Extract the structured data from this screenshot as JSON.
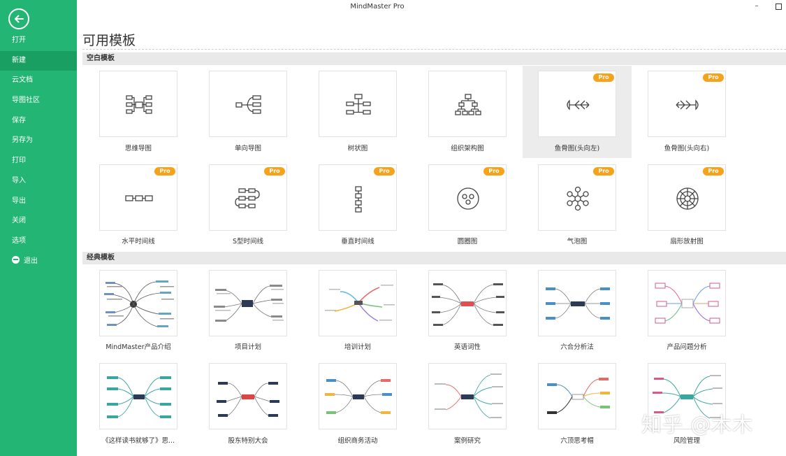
{
  "app_title": "MindMaster Pro",
  "window": {
    "minimize_label": "–",
    "maximize_label": ""
  },
  "sidebar": {
    "items": [
      {
        "label": "打开"
      },
      {
        "label": "新建"
      },
      {
        "label": "云文档"
      },
      {
        "label": "导图社区"
      },
      {
        "label": "保存"
      },
      {
        "label": "另存为"
      },
      {
        "label": "打印"
      },
      {
        "label": "导入"
      },
      {
        "label": "导出"
      },
      {
        "label": "关闭"
      },
      {
        "label": "选项"
      },
      {
        "label": "退出"
      }
    ],
    "active_index": 1
  },
  "page_title": "可用模板",
  "sections": {
    "blank": {
      "label": "空白模板",
      "tiles": [
        {
          "label": "思维导图",
          "pro": "",
          "icon": "mindmap-icon"
        },
        {
          "label": "单向导图",
          "pro": "",
          "icon": "right-map-icon"
        },
        {
          "label": "树状图",
          "pro": "",
          "icon": "tree-icon"
        },
        {
          "label": "组织架构图",
          "pro": "",
          "icon": "org-chart-icon"
        },
        {
          "label": "鱼骨图(头向左)",
          "pro": "Pro",
          "icon": "fishbone-left-icon"
        },
        {
          "label": "鱼骨图(头向右)",
          "pro": "Pro",
          "icon": "fishbone-right-icon"
        },
        {
          "label": "水平时间线",
          "pro": "Pro",
          "icon": "horizontal-timeline-icon"
        },
        {
          "label": "S型时间线",
          "pro": "Pro",
          "icon": "s-timeline-icon"
        },
        {
          "label": "垂直时间线",
          "pro": "Pro",
          "icon": "vertical-timeline-icon"
        },
        {
          "label": "圆圈图",
          "pro": "Pro",
          "icon": "circle-map-icon"
        },
        {
          "label": "气泡图",
          "pro": "Pro",
          "icon": "bubble-map-icon"
        },
        {
          "label": "扇形放射图",
          "pro": "Pro",
          "icon": "radial-fan-icon"
        }
      ]
    },
    "classic": {
      "label": "经典模板",
      "tiles": [
        {
          "label": "MindMaster产品介绍"
        },
        {
          "label": "项目计划"
        },
        {
          "label": "培训计划"
        },
        {
          "label": "英语词性"
        },
        {
          "label": "六合分析法"
        },
        {
          "label": "产品问题分析"
        },
        {
          "label": "《这样读书就够了》思..."
        },
        {
          "label": "股东特别大会"
        },
        {
          "label": "组织商务活动"
        },
        {
          "label": "案例研究"
        },
        {
          "label": "六顶思考帽"
        },
        {
          "label": "风险管理"
        }
      ]
    }
  },
  "watermark": "知乎 @木木"
}
